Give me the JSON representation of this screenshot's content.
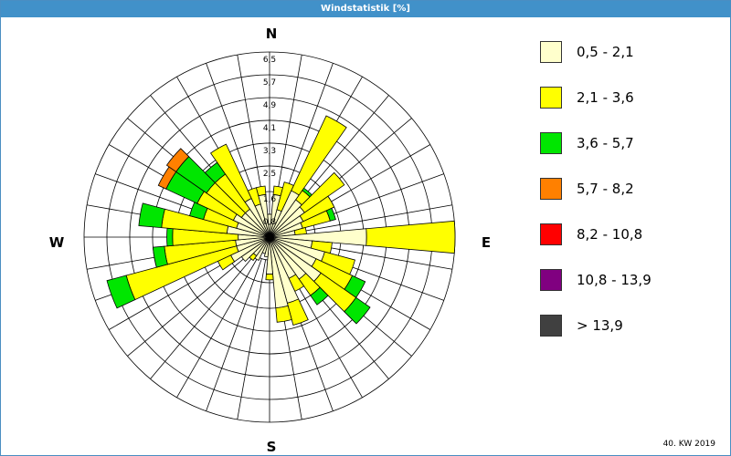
{
  "chart_data": {
    "type": "wind-rose",
    "title": "Windstatistik [%]",
    "footer": "40. KW 2019",
    "directions": [
      "N",
      "E",
      "S",
      "W"
    ],
    "ring_labels": [
      "0,8",
      "1,6",
      "2,5",
      "3,3",
      "4,1",
      "4,9",
      "5,7",
      "6,5"
    ],
    "ring_values": [
      0.8,
      1.6,
      2.5,
      3.3,
      4.1,
      4.9,
      5.7,
      6.5
    ],
    "r_max": 6.5,
    "legend": [
      "0,5 - 2,1",
      "2,1 - 3,6",
      "3,6 - 5,7",
      "5,7 - 8,2",
      "8,2 - 10,8",
      "10,8 - 13,9",
      "> 13,9"
    ],
    "colors": [
      "#ffffcc",
      "#ffff00",
      "#00e600",
      "#ff8000",
      "#ff0000",
      "#800080",
      "#404040"
    ],
    "sector_width_deg": 10,
    "sectors": [
      {
        "dir": 10,
        "bins": [
          1.5,
          0.3
        ]
      },
      {
        "dir": 20,
        "bins": [
          1.0,
          1.0
        ]
      },
      {
        "dir": 30,
        "bins": [
          1.8,
          2.9
        ]
      },
      {
        "dir": 40,
        "bins": [
          1.6,
          0.4,
          0.1
        ]
      },
      {
        "dir": 50,
        "bins": [
          1.5,
          1.7
        ]
      },
      {
        "dir": 60,
        "bins": [
          1.3,
          1.2
        ]
      },
      {
        "dir": 70,
        "bins": [
          1.2,
          1.0,
          0.2
        ]
      },
      {
        "dir": 80,
        "bins": [
          0.9,
          0.4
        ]
      },
      {
        "dir": 90,
        "bins": [
          3.4,
          3.1
        ]
      },
      {
        "dir": 100,
        "bins": [
          1.5,
          0.7
        ]
      },
      {
        "dir": 110,
        "bins": [
          2.0,
          1.1
        ]
      },
      {
        "dir": 120,
        "bins": [
          1.8,
          1.4,
          0.5
        ]
      },
      {
        "dir": 130,
        "bins": [
          2.2,
          1.5,
          0.6
        ]
      },
      {
        "dir": 140,
        "bins": [
          1.8,
          0.7,
          0.4
        ]
      },
      {
        "dir": 150,
        "bins": [
          1.6,
          0.5
        ]
      },
      {
        "dir": 160,
        "bins": [
          2.4,
          0.8
        ]
      },
      {
        "dir": 170,
        "bins": [
          2.5,
          0.5
        ]
      },
      {
        "dir": 180,
        "bins": [
          1.3,
          0.2
        ]
      },
      {
        "dir": 190,
        "bins": [
          0.7
        ]
      },
      {
        "dir": 200,
        "bins": [
          0.6
        ]
      },
      {
        "dir": 210,
        "bins": [
          0.9
        ]
      },
      {
        "dir": 220,
        "bins": [
          0.8,
          0.2
        ]
      },
      {
        "dir": 230,
        "bins": [
          1.2
        ]
      },
      {
        "dir": 240,
        "bins": [
          1.5,
          0.5
        ]
      },
      {
        "dir": 250,
        "bins": [
          1.2,
          4.0,
          0.7
        ]
      },
      {
        "dir": 260,
        "bins": [
          1.2,
          2.5,
          0.4
        ]
      },
      {
        "dir": 270,
        "bins": [
          1.1,
          2.3,
          0.2
        ]
      },
      {
        "dir": 280,
        "bins": [
          1.5,
          2.3,
          0.8
        ]
      },
      {
        "dir": 290,
        "bins": [
          1.2,
          1.2,
          0.5
        ]
      },
      {
        "dir": 300,
        "bins": [
          1.4,
          1.4,
          1.2,
          0.3
        ]
      },
      {
        "dir": 310,
        "bins": [
          1.2,
          1.5,
          1.3,
          0.4
        ]
      },
      {
        "dir": 320,
        "bins": [
          1.2,
          1.5,
          0.5
        ]
      },
      {
        "dir": 330,
        "bins": [
          1.5,
          2.1
        ]
      },
      {
        "dir": 340,
        "bins": [
          1.2,
          0.6
        ]
      },
      {
        "dir": 350,
        "bins": [
          1.5,
          0.3
        ]
      },
      {
        "dir": 360,
        "bins": [
          0.8
        ]
      }
    ]
  },
  "compass": {
    "north": "N",
    "east": "E",
    "south": "S",
    "west": "W"
  }
}
